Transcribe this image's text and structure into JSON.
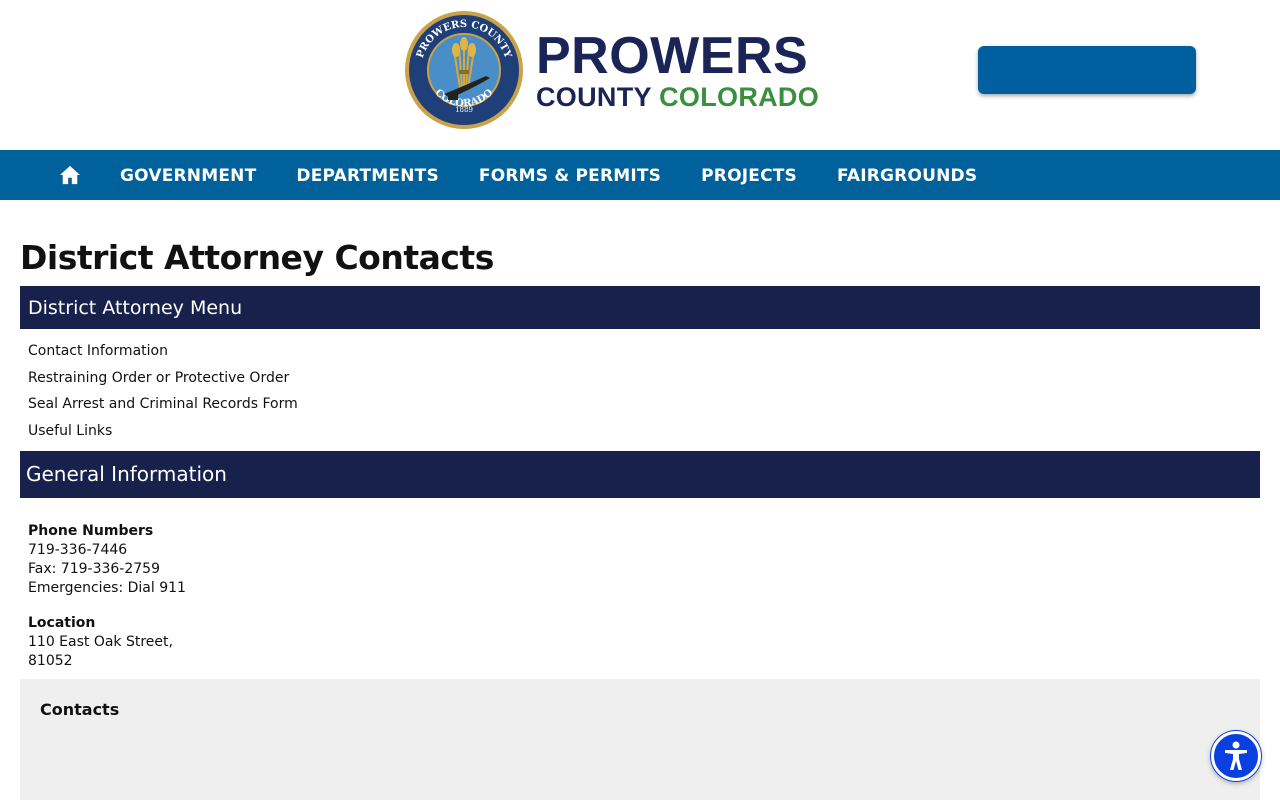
{
  "brand": {
    "name_line1": "PROWERS",
    "name_county": "COUNTY",
    "name_colorado": "COLORADO",
    "seal_text_top": "PROWERS COUNTY",
    "seal_text_bottom": "COLORADO",
    "seal_year": "1889",
    "colors": {
      "navy": "#1a2456",
      "green": "#3a8f3f",
      "nav_blue": "#00619b",
      "section_navy": "#17214b"
    }
  },
  "nav": {
    "home_icon": "home-icon",
    "items": [
      {
        "label": "GOVERNMENT"
      },
      {
        "label": "DEPARTMENTS"
      },
      {
        "label": "FORMS & PERMITS"
      },
      {
        "label": "PROJECTS"
      },
      {
        "label": "FAIRGROUNDS"
      }
    ]
  },
  "page": {
    "title": "District Attorney Contacts"
  },
  "menu": {
    "header": "District Attorney Menu",
    "links": [
      {
        "label": "Contact Information"
      },
      {
        "label": "Restraining Order or Protective Order"
      },
      {
        "label": "Seal Arrest and Criminal Records Form"
      },
      {
        "label": "Useful Links"
      }
    ]
  },
  "general": {
    "header": "General Information",
    "phone_label": "Phone Numbers",
    "phone": "719-336-7446",
    "fax": "Fax: 719-336-2759",
    "emergencies": "Emergencies: Dial 911",
    "location_label": "Location",
    "address_line1": "110 East Oak Street,",
    "address_line2": "81052"
  },
  "contacts": {
    "heading": "Contacts"
  },
  "accessibility": {
    "icon": "accessibility-icon"
  }
}
